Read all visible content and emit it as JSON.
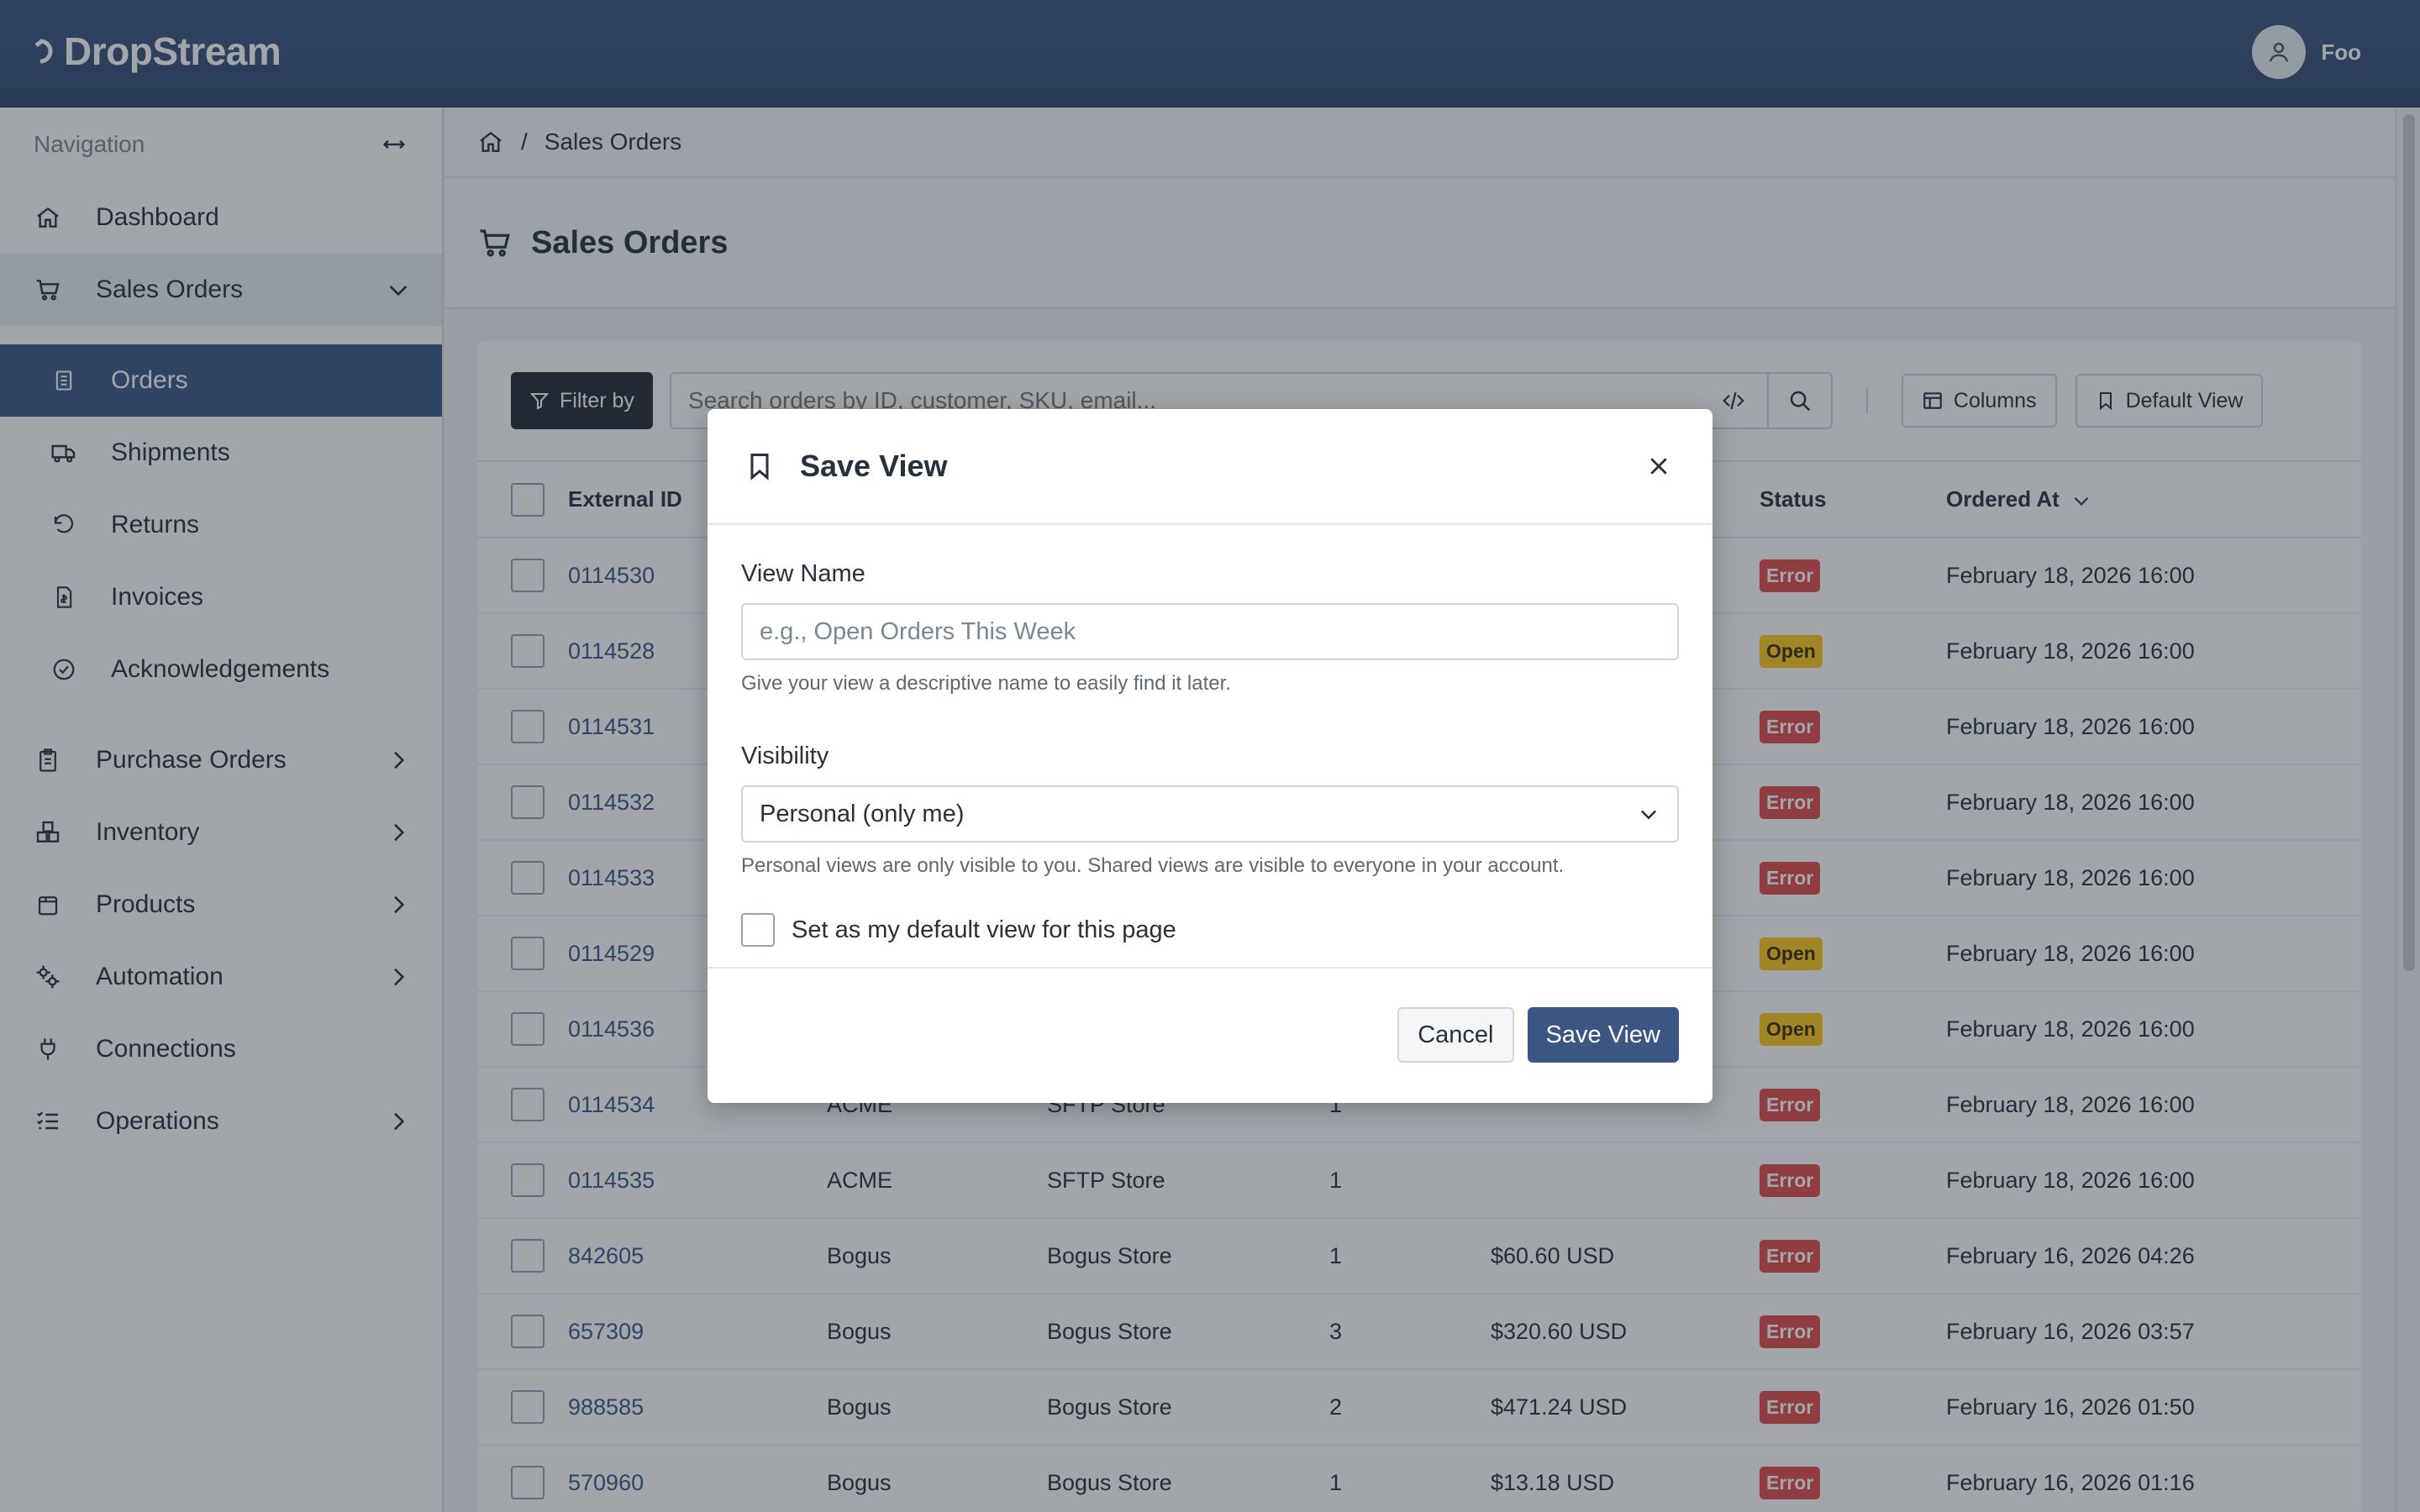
{
  "app": {
    "brand": "DropStream",
    "user_name": "Foo"
  },
  "sidebar": {
    "heading": "Navigation",
    "items": [
      {
        "label": "Dashboard",
        "icon": "home-icon"
      },
      {
        "label": "Sales Orders",
        "icon": "cart-icon",
        "expanded": true
      },
      {
        "label": "Purchase Orders",
        "icon": "clipboard-icon"
      },
      {
        "label": "Inventory",
        "icon": "boxes-icon"
      },
      {
        "label": "Products",
        "icon": "package-icon"
      },
      {
        "label": "Automation",
        "icon": "gears-icon"
      },
      {
        "label": "Connections",
        "icon": "plug-icon"
      },
      {
        "label": "Operations",
        "icon": "list-icon"
      }
    ],
    "sub_items": [
      {
        "label": "Orders",
        "icon": "document-icon",
        "active": true
      },
      {
        "label": "Shipments",
        "icon": "truck-icon"
      },
      {
        "label": "Returns",
        "icon": "undo-icon"
      },
      {
        "label": "Invoices",
        "icon": "invoice-icon"
      },
      {
        "label": "Acknowledgements",
        "icon": "check-circle-icon"
      }
    ]
  },
  "breadcrumb": {
    "separator": "/",
    "current": "Sales Orders"
  },
  "page": {
    "title": "Sales Orders"
  },
  "toolbar": {
    "filter_label": "Filter by",
    "search_placeholder": "Search orders by ID, customer, SKU, email...",
    "columns_label": "Columns",
    "view_label": "Default View"
  },
  "table": {
    "headers": {
      "external_id": "External ID",
      "status": "Status",
      "ordered_at": "Ordered At"
    },
    "rows": [
      {
        "id": "0114530",
        "customer": "",
        "store": "",
        "qty": "",
        "total": "",
        "status": "Error",
        "date": "February 18, 2026 16:00"
      },
      {
        "id": "0114528",
        "customer": "",
        "store": "",
        "qty": "",
        "total": "",
        "status": "Open",
        "date": "February 18, 2026 16:00"
      },
      {
        "id": "0114531",
        "customer": "",
        "store": "",
        "qty": "",
        "total": "",
        "status": "Error",
        "date": "February 18, 2026 16:00"
      },
      {
        "id": "0114532",
        "customer": "",
        "store": "",
        "qty": "",
        "total": "",
        "status": "Error",
        "date": "February 18, 2026 16:00"
      },
      {
        "id": "0114533",
        "customer": "",
        "store": "",
        "qty": "",
        "total": "",
        "status": "Error",
        "date": "February 18, 2026 16:00"
      },
      {
        "id": "0114529",
        "customer": "",
        "store": "",
        "qty": "",
        "total": "",
        "status": "Open",
        "date": "February 18, 2026 16:00"
      },
      {
        "id": "0114536",
        "customer": "",
        "store": "",
        "qty": "",
        "total": "",
        "status": "Open",
        "date": "February 18, 2026 16:00"
      },
      {
        "id": "0114534",
        "customer": "ACME",
        "store": "SFTP Store",
        "qty": "1",
        "total": "",
        "status": "Error",
        "date": "February 18, 2026 16:00"
      },
      {
        "id": "0114535",
        "customer": "ACME",
        "store": "SFTP Store",
        "qty": "1",
        "total": "",
        "status": "Error",
        "date": "February 18, 2026 16:00"
      },
      {
        "id": "842605",
        "customer": "Bogus",
        "store": "Bogus Store",
        "qty": "1",
        "total": "$60.60 USD",
        "status": "Error",
        "date": "February 16, 2026 04:26"
      },
      {
        "id": "657309",
        "customer": "Bogus",
        "store": "Bogus Store",
        "qty": "3",
        "total": "$320.60 USD",
        "status": "Error",
        "date": "February 16, 2026 03:57"
      },
      {
        "id": "988585",
        "customer": "Bogus",
        "store": "Bogus Store",
        "qty": "2",
        "total": "$471.24 USD",
        "status": "Error",
        "date": "February 16, 2026 01:50"
      },
      {
        "id": "570960",
        "customer": "Bogus",
        "store": "Bogus Store",
        "qty": "1",
        "total": "$13.18 USD",
        "status": "Error",
        "date": "February 16, 2026 01:16"
      }
    ]
  },
  "modal": {
    "title": "Save View",
    "name_label": "View Name",
    "name_placeholder": "e.g., Open Orders This Week",
    "name_help": "Give your view a descriptive name to easily find it later.",
    "visibility_label": "Visibility",
    "visibility_value": "Personal (only me)",
    "visibility_help": "Personal views are only visible to you. Shared views are visible to everyone in your account.",
    "default_label": "Set as my default view for this page",
    "cancel_label": "Cancel",
    "save_label": "Save View"
  },
  "colors": {
    "brand": "#3b5683",
    "error": "#e04b4b",
    "open": "#ffc61a"
  }
}
